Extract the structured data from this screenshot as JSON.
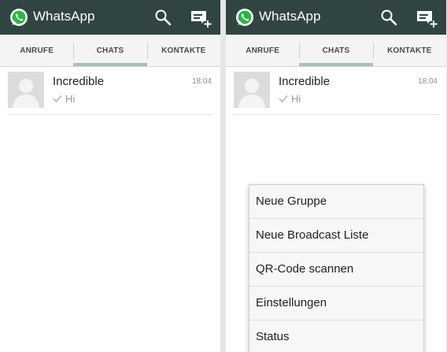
{
  "app": {
    "title": "WhatsApp"
  },
  "tabs": [
    {
      "label": "ANRUFE"
    },
    {
      "label": "CHATS",
      "active": true
    },
    {
      "label": "KONTAKTE"
    }
  ],
  "chats": [
    {
      "name": "Incredible",
      "time": "18:04",
      "preview": "Hi",
      "status": "sent"
    }
  ],
  "overflow_menu": {
    "items": [
      {
        "label": "Neue Gruppe"
      },
      {
        "label": "Neue Broadcast Liste"
      },
      {
        "label": "QR-Code scannen"
      },
      {
        "label": "Einstellungen"
      },
      {
        "label": "Status"
      }
    ]
  },
  "colors": {
    "appbar": "#304441",
    "tab_indicator": "#a6bfbd",
    "whatsapp_green": "#2fb44a"
  },
  "icons": {
    "logo": "whatsapp-logo-icon",
    "search": "search-icon",
    "new_chat": "new-chat-icon",
    "avatar": "default-avatar-icon",
    "tick": "checkmark-icon"
  }
}
